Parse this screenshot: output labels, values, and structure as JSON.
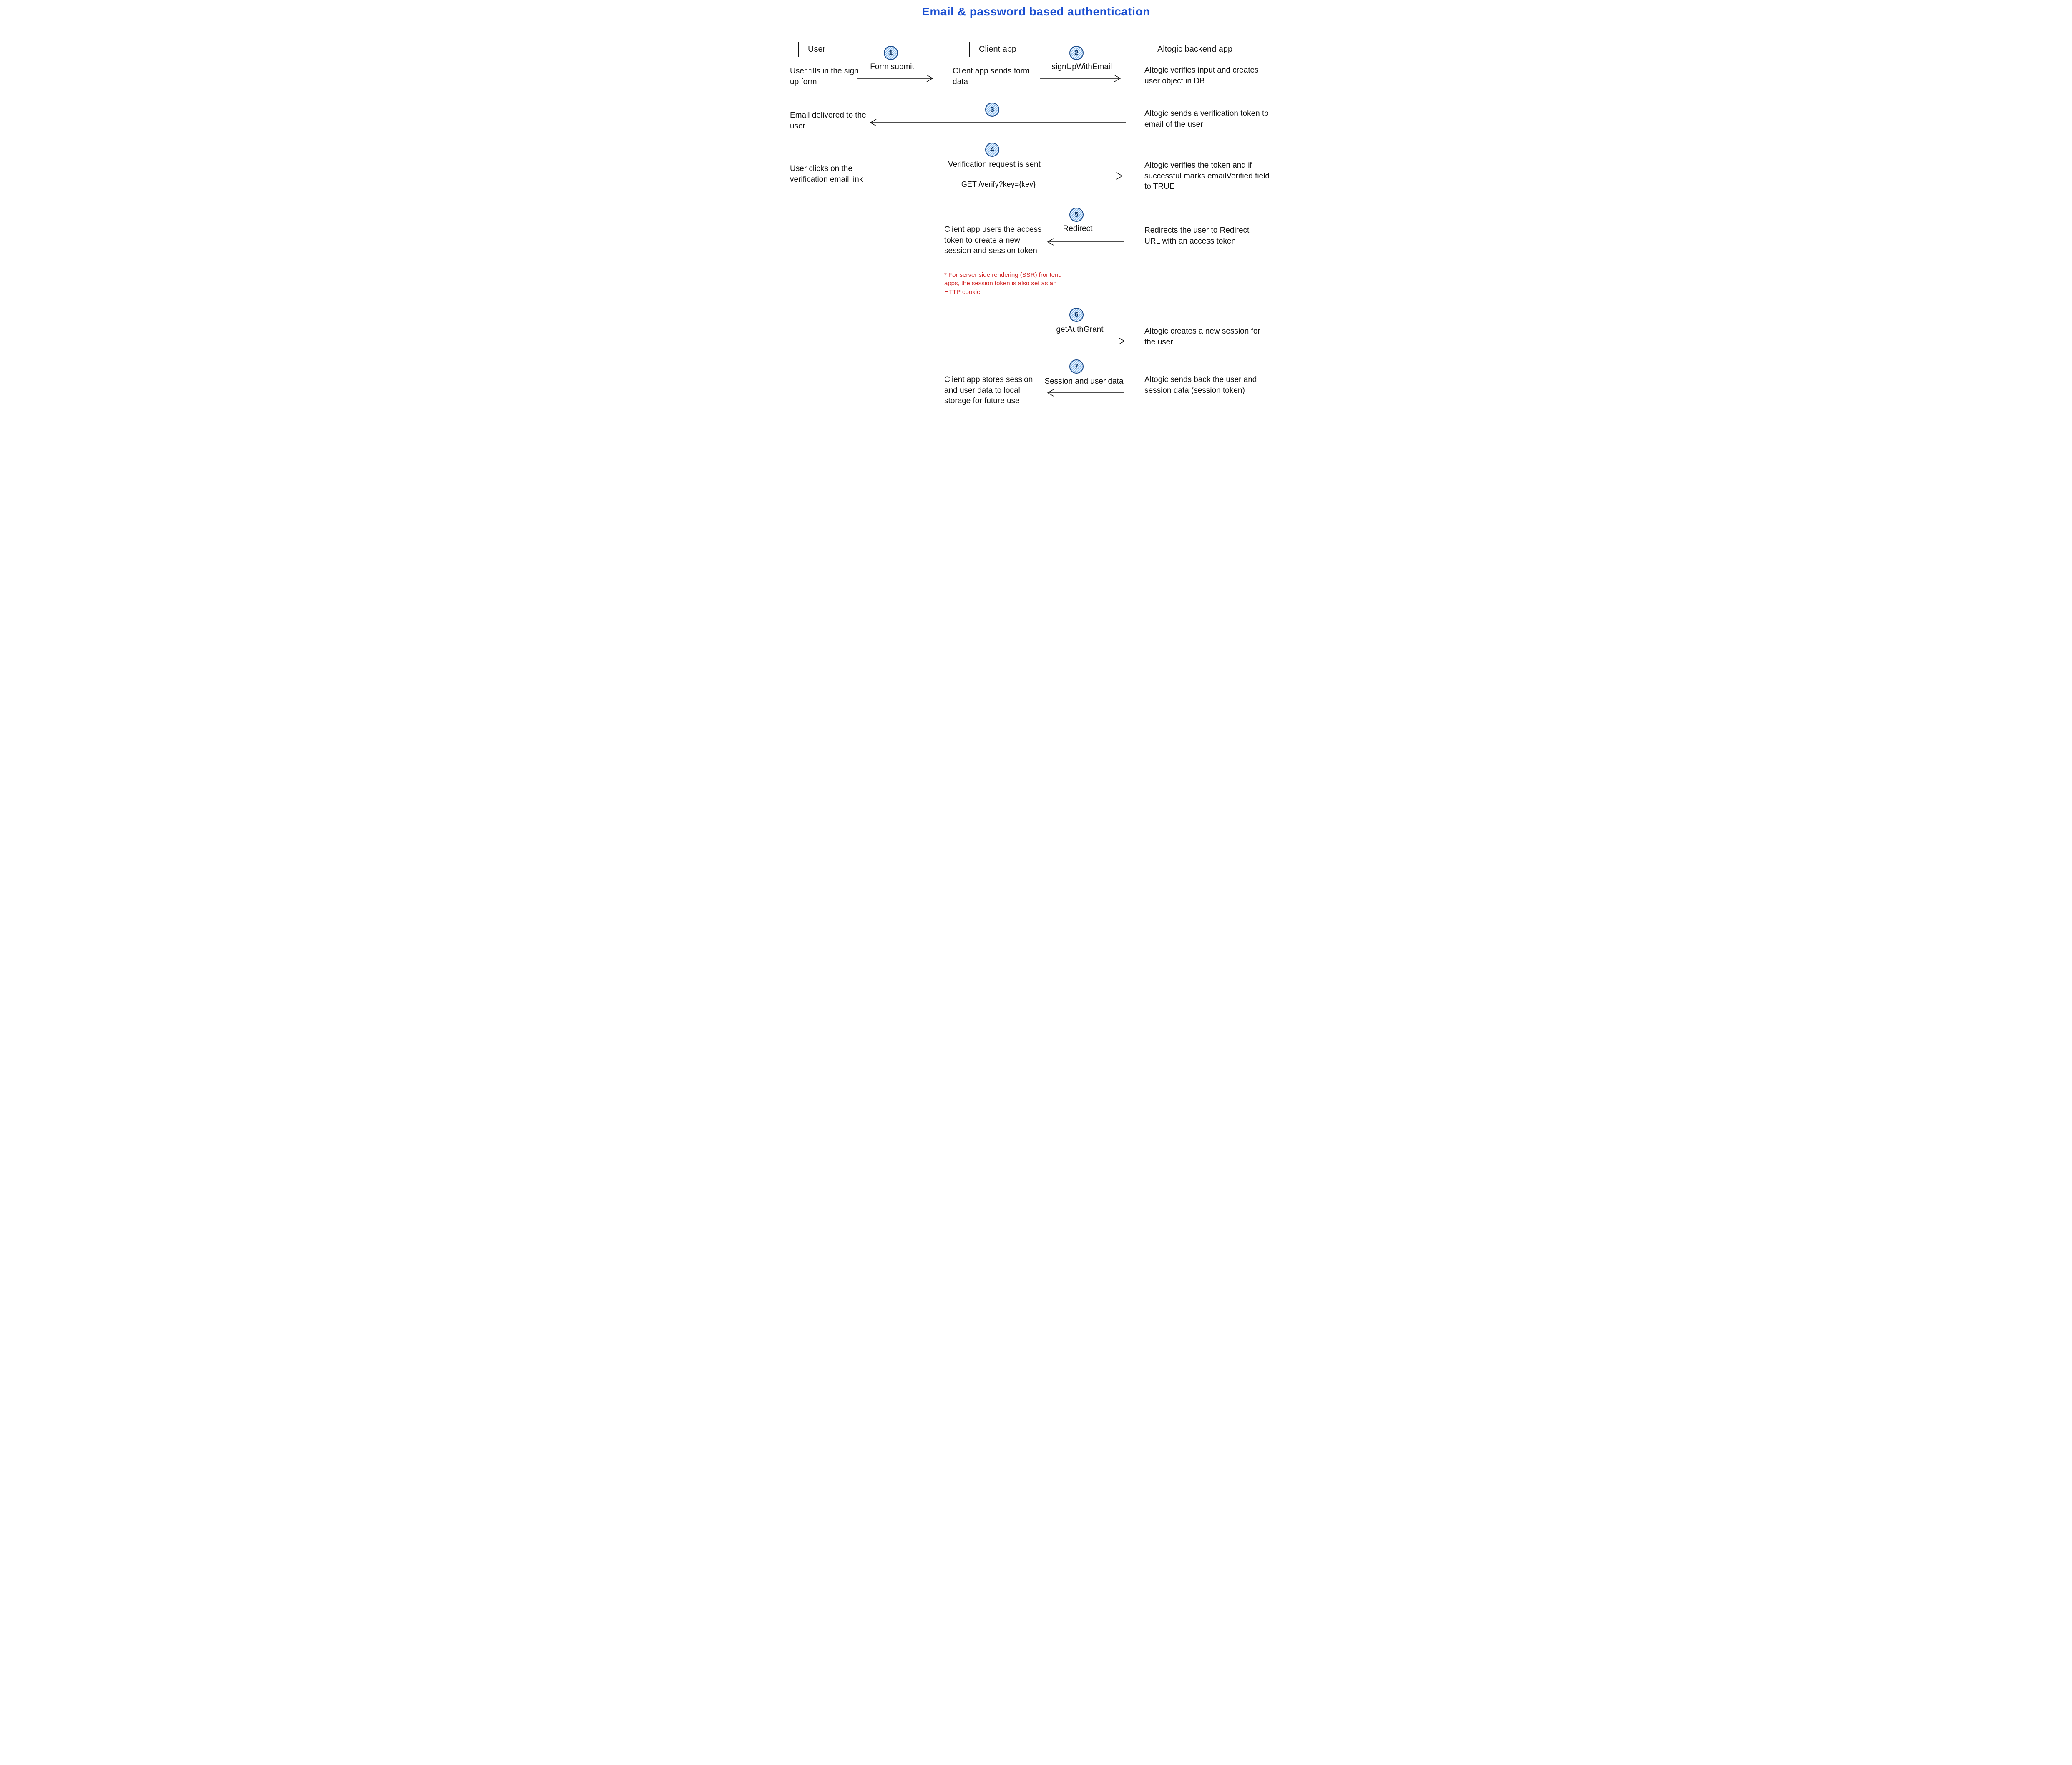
{
  "title": "Email & password based authentication",
  "lanes": {
    "user": "User",
    "client": "Client app",
    "backend": "Altogic backend app"
  },
  "texts": {
    "user_fills": "User fills in the sign up form",
    "form_submit": "Form submit",
    "client_sends": "Client app sends form data",
    "signup": "signUpWithEmail",
    "altogic_verify_input": "Altogic verifies input and creates user object in DB",
    "email_delivered": "Email delivered to the user",
    "altogic_sends_token": "Altogic sends a verification token to email of the user",
    "user_clicks": "User clicks on the verification email link",
    "verification_sent": "Verification request is sent",
    "get_verify": "GET /verify?key={key}",
    "altogic_verifies_token": "Altogic verifies the token and if successful marks emailVerified field to TRUE",
    "redirect": "Redirect",
    "client_uses_token": "Client app users the access token to create a new session and session token",
    "ssr_note": "* For server side rendering (SSR) frontend apps, the session token is also set as an HTTP cookie",
    "redirects_user": "Redirects the user to Redirect URL with an access token",
    "get_auth_grant": "getAuthGrant",
    "altogic_creates_session": "Altogic creates a new session for the user",
    "session_and_user": "Session and user data",
    "client_stores": "Client app stores session and user data to local storage for future use",
    "altogic_sends_back": "Altogic sends back the user and session data (session token)"
  },
  "steps": {
    "s1": "1",
    "s2": "2",
    "s3": "3",
    "s4": "4",
    "s5": "5",
    "s6": "6",
    "s7": "7"
  }
}
